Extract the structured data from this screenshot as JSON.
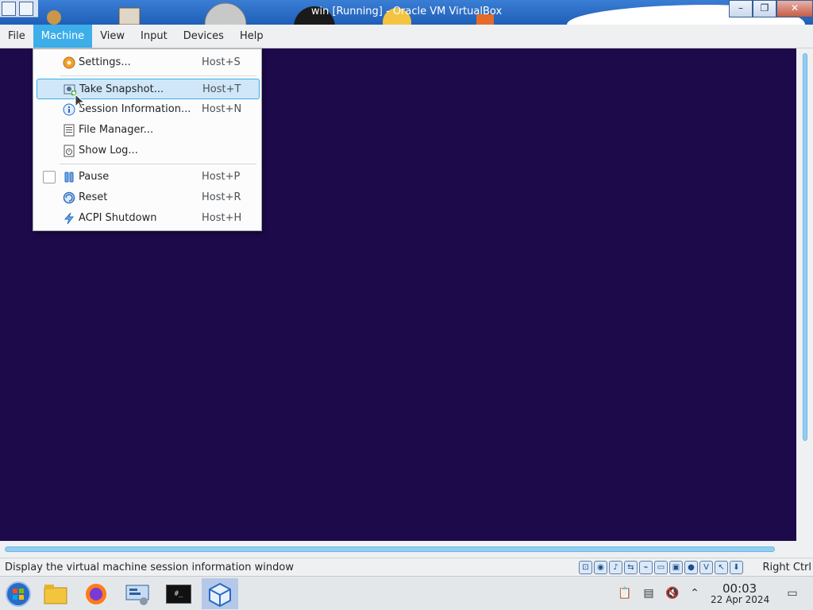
{
  "window": {
    "title": "win [Running] - Oracle VM VirtualBox",
    "minimize_glyph": "–",
    "maximize_glyph": "❐",
    "close_glyph": "✕"
  },
  "menubar": {
    "items": [
      {
        "label": "File"
      },
      {
        "label": "Machine",
        "active": true
      },
      {
        "label": "View"
      },
      {
        "label": "Input"
      },
      {
        "label": "Devices"
      },
      {
        "label": "Help"
      }
    ]
  },
  "machine_menu": {
    "items": [
      {
        "label": "Settings...",
        "shortcut": "Host+S",
        "icon": "gear-icon"
      },
      {
        "label": "Take Snapshot...",
        "shortcut": "Host+T",
        "icon": "snapshot-icon",
        "highlighted": true
      },
      {
        "label": "Session Information...",
        "shortcut": "Host+N",
        "icon": "info-icon"
      },
      {
        "label": "File Manager...",
        "shortcut": "",
        "icon": "file-manager-icon"
      },
      {
        "label": "Show Log...",
        "shortcut": "",
        "icon": "log-icon"
      },
      {
        "label": "Pause",
        "shortcut": "Host+P",
        "icon": "pause-icon",
        "checkbox": true,
        "checked": false
      },
      {
        "label": "Reset",
        "shortcut": "Host+R",
        "icon": "reset-icon"
      },
      {
        "label": "ACPI Shutdown",
        "shortcut": "Host+H",
        "icon": "acpi-shutdown-icon"
      }
    ]
  },
  "statusbar": {
    "message": "Display the virtual machine session information window",
    "host_key": "Right Ctrl",
    "indicators": [
      "hard-disk-icon",
      "optical-drive-icon",
      "audio-icon",
      "network-icon",
      "usb-icon",
      "shared-folders-icon",
      "display-icon",
      "recording-icon",
      "virtualization-icon",
      "mouse-integration-icon",
      "keyboard-icon"
    ]
  },
  "taskbar": {
    "apps": [
      "start-menu-icon",
      "file-manager-icon",
      "firefox-icon",
      "system-settings-icon",
      "terminal-icon",
      "virtualbox-icon"
    ],
    "terminal_glyph": "#_",
    "clock_time": "00:03",
    "clock_date": "22 Apr 2024"
  },
  "colors": {
    "accent": "#3daee9",
    "vm_background": "#1c0a4a",
    "titlebar": "#1f5fb8"
  }
}
